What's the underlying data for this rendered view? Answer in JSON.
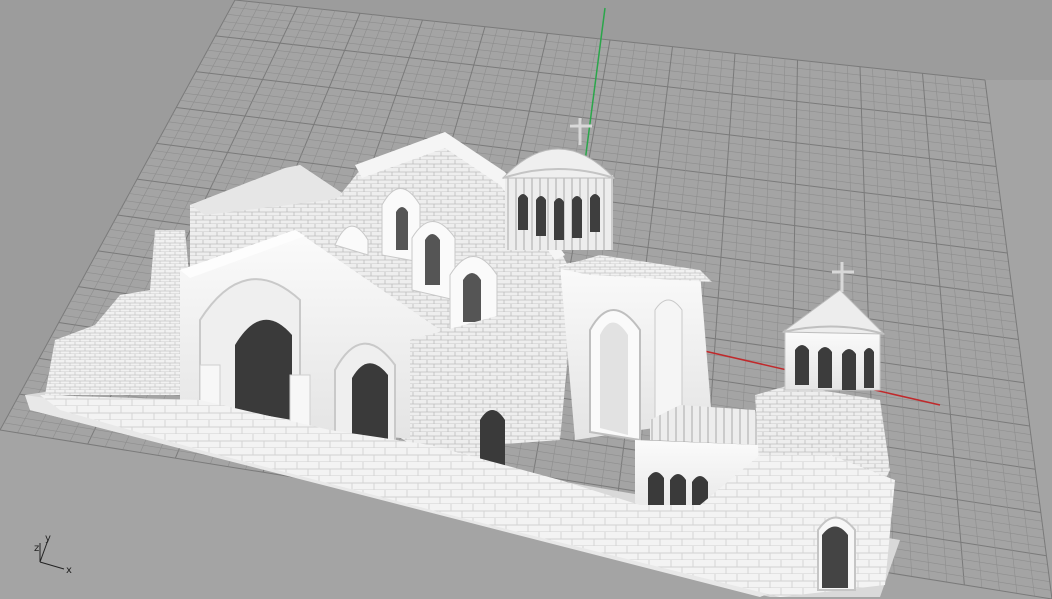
{
  "viewport": {
    "background": "#9c9c9c",
    "grid_minor_color": "#8e8e8e",
    "grid_major_color": "#7a7a7a",
    "axis_x_color": "#c0292b",
    "axis_y_color": "#2aa64a",
    "model_color": "#f2f2f2"
  },
  "axis_widget": {
    "x_label": "x",
    "y_label": "y",
    "z_label": "z",
    "icon": "axes-triad-icon"
  }
}
